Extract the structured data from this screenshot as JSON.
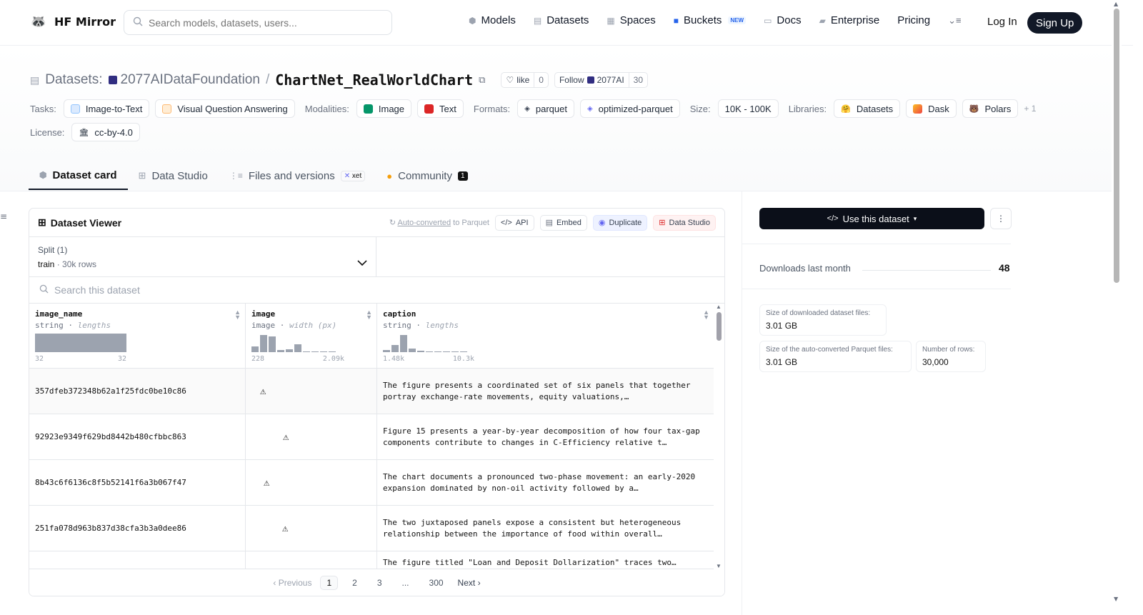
{
  "nav": {
    "brand": "HF Mirror",
    "search_placeholder": "Search models, datasets, users...",
    "items": [
      {
        "label": "Models",
        "icon": "cube-icon"
      },
      {
        "label": "Datasets",
        "icon": "database-icon"
      },
      {
        "label": "Spaces",
        "icon": "grid-icon"
      },
      {
        "label": "Buckets",
        "icon": "bucket-icon",
        "badge": "NEW"
      },
      {
        "label": "Docs",
        "icon": "book-icon"
      },
      {
        "label": "Enterprise",
        "icon": "briefcase-icon"
      },
      {
        "label": "Pricing"
      }
    ],
    "login": "Log In",
    "signup": "Sign Up"
  },
  "header": {
    "section": "Datasets:",
    "org": "2077AIDataFoundation",
    "separator": "/",
    "name": "ChartNet_RealWorldChart",
    "like_label": "like",
    "like_count": "0",
    "follow_label": "Follow",
    "follow_org": "2077AI",
    "follow_count": "30"
  },
  "meta": {
    "tasks_label": "Tasks:",
    "tasks": [
      "Image-to-Text",
      "Visual Question Answering"
    ],
    "modalities_label": "Modalities:",
    "modalities": [
      "Image",
      "Text"
    ],
    "formats_label": "Formats:",
    "formats": [
      "parquet",
      "optimized-parquet"
    ],
    "size_label": "Size:",
    "size": "10K - 100K",
    "libraries_label": "Libraries:",
    "libraries": [
      "Datasets",
      "Dask",
      "Polars"
    ],
    "libraries_more": "+ 1",
    "license_label": "License:",
    "license": "cc-by-4.0"
  },
  "tabs": {
    "card": "Dataset card",
    "studio": "Data Studio",
    "files": "Files and versions",
    "files_badge": "xet",
    "community": "Community",
    "community_count": "1"
  },
  "viewer": {
    "title": "Dataset Viewer",
    "auto_link": "Auto-converted",
    "auto_rest": " to Parquet",
    "api": "API",
    "embed": "Embed",
    "duplicate": "Duplicate",
    "data_studio": "Data Studio",
    "split_label": "Split (1)",
    "split_name": "train",
    "split_dot": "·",
    "split_rows": "30k rows",
    "search_placeholder": "Search this dataset",
    "columns": [
      {
        "name": "image_name",
        "type": "string",
        "stat": "lengths",
        "min": "32",
        "max": "32"
      },
      {
        "name": "image",
        "type": "image",
        "stat": "width (px)",
        "min": "228",
        "max": "2.09k"
      },
      {
        "name": "caption",
        "type": "string",
        "stat": "lengths",
        "min": "1.48k",
        "max": "10.3k"
      }
    ],
    "rows": [
      {
        "image_name": "357dfeb372348b62a1f25fdc0be10c86",
        "caption": "The figure presents a coordinated set of six panels that together portray exchange-rate movements, equity valuations,…"
      },
      {
        "image_name": "92923e9349f629bd8442b480cfbbc863",
        "caption": "Figure 15 presents a year-by-year decomposition of how four tax-gap components contribute to changes in C-Efficiency relative t…"
      },
      {
        "image_name": "8b43c6f6136c8f5b52141f6a3b067f47",
        "caption": "The chart documents a pronounced two-phase movement: an early-2020 expansion dominated by non-oil activity followed by a…"
      },
      {
        "image_name": "251fa078d963b837d38cfa3b3a0dee86",
        "caption": "The two juxtaposed panels expose a consistent but heterogeneous relationship between the importance of food within overall…"
      },
      {
        "image_name": "",
        "caption": "The figure titled \"Loan and Deposit Dollarization\" traces two…"
      }
    ],
    "pager": {
      "prev": "Previous",
      "pages": [
        "1",
        "2",
        "3",
        "...",
        "300"
      ],
      "next": "Next"
    }
  },
  "sidebar": {
    "use_button": "Use this dataset",
    "downloads_label": "Downloads last month",
    "downloads_value": "48",
    "stats": [
      {
        "label": "Size of downloaded dataset files:",
        "value": "3.01 GB"
      },
      {
        "label": "Size of the auto-converted Parquet files:",
        "value": "3.01 GB"
      },
      {
        "label": "Number of rows:",
        "value": "30,000"
      }
    ]
  },
  "colors": {
    "accent": "#111827",
    "org_square": "#312e81"
  }
}
